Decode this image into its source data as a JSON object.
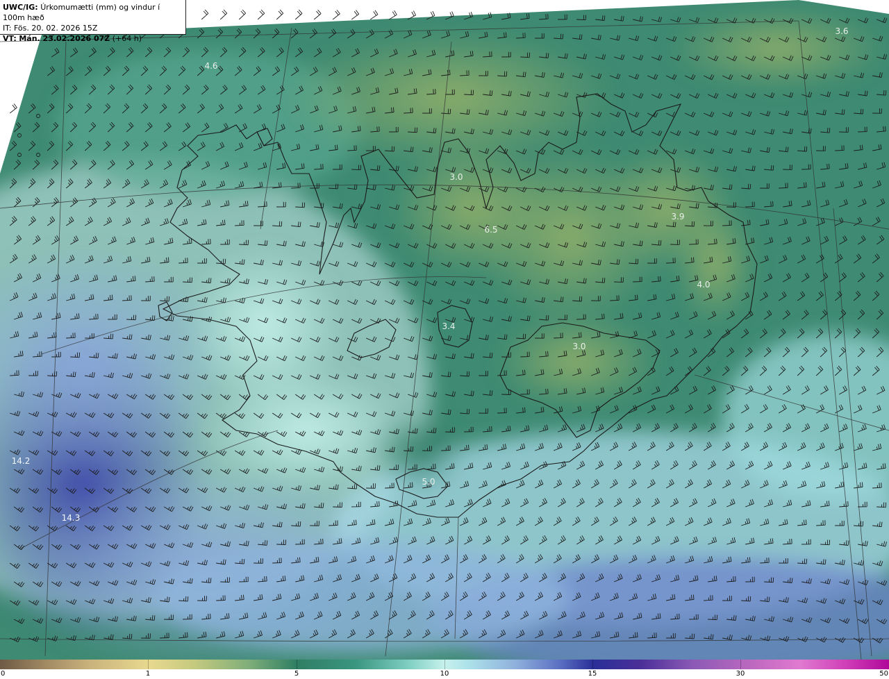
{
  "header": {
    "title_prefix": "UWC/IG:",
    "title_text": "Úrkomumætti (mm) og vindur í 100m hæð",
    "issue_time": "IT: Fös. 20. 02. 2026 15Z",
    "valid_time_prefix": "VT:",
    "valid_time_bold": "Mán. 23.02.2026 07Z",
    "valid_time_suffix": "(+64 h)"
  },
  "map_values": [
    {
      "id": "v1",
      "text": "4.6"
    },
    {
      "id": "v2",
      "text": "3.6"
    },
    {
      "id": "v3",
      "text": "3.0"
    },
    {
      "id": "v4",
      "text": "6.5"
    },
    {
      "id": "v5",
      "text": "3.9"
    },
    {
      "id": "v6",
      "text": "4.0"
    },
    {
      "id": "v7",
      "text": "3.4"
    },
    {
      "id": "v8",
      "text": "3.0"
    },
    {
      "id": "v9",
      "text": "5.0"
    },
    {
      "id": "v10",
      "text": "14.2"
    },
    {
      "id": "v11",
      "text": "14.3"
    }
  ],
  "colorbar": {
    "ticks": [
      "0",
      "1",
      "5",
      "10",
      "15",
      "30",
      "50"
    ],
    "colors": {
      "low": "#6e5a45",
      "mid": "#2f7e63",
      "ten": "#c7f1ec",
      "fifteen": "#2a2f98",
      "high": "#b0089a"
    }
  },
  "legend_icons": {
    "wind": "wind-barb-icon",
    "calm": "calm-circle-icon"
  }
}
